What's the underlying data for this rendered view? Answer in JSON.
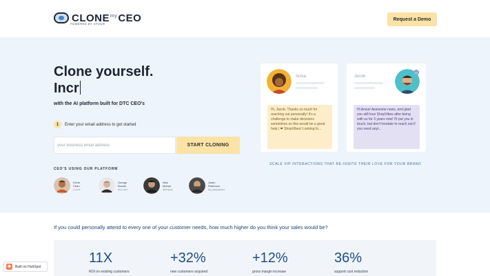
{
  "header": {
    "logo_text_left": "CLONE",
    "logo_text_my": "my",
    "logo_text_right": "CEO",
    "logo_sub": "POWERED BY CFOUR",
    "demo_button": "Request a Demo"
  },
  "hero": {
    "title_line1": "Clone yourself.",
    "title_line2": "Incr",
    "subtitle": "with the AI platform built for DTC CEO's",
    "step_number": "1",
    "step_text": "Enter your email address to get started",
    "email_placeholder": "your business email address",
    "cta_button": "START CLONING",
    "ceo_label": "CEO'S USING OUR PLATFORM",
    "ceos": [
      {
        "name1": "Kevin",
        "name2": "Chau",
        "brand": "Luxxe"
      },
      {
        "name1": "George",
        "name2": "Bousis",
        "brand": "brd.com"
      },
      {
        "name1": "Nick",
        "name2": "Molnar",
        "brand": "afterpay"
      },
      {
        "name1": "Justin",
        "name2": "Robinson",
        "brand": "by pawpalace"
      }
    ]
  },
  "chat": {
    "left_name": "Anisa",
    "right_name": "Jacob",
    "ai_badge": "AI",
    "left_message": "Hi, Jacob, Thanks so much for reaching out personally! It's a challenge to make decisions sometimes so this would be a great help | ❤ ShopVibes! Looking fo...",
    "right_message": "Hi Anisa! Awesome news, and glad you still love ShopVibes after being with us for 3 years now! I'll put you in touch, but don't hesitate to reach out if you need anyt...",
    "caption": "SCALE VIP INTERACTIONS THAT RE-IGNITE THEIR LOVE FOR YOUR BRAND"
  },
  "roi": {
    "question": "If you could personally attend to every one of your customer needs, how much higher do you think your sales would be?",
    "stats": [
      {
        "value": "11X",
        "label": "ROI on existing customers"
      },
      {
        "value": "+32%",
        "label": "new customers acquired"
      },
      {
        "value": "+12%",
        "label": "gross margin increase"
      },
      {
        "value": "36%",
        "label": "support cost reduction"
      }
    ]
  },
  "hubspot_badge": "Built on HubSpot"
}
